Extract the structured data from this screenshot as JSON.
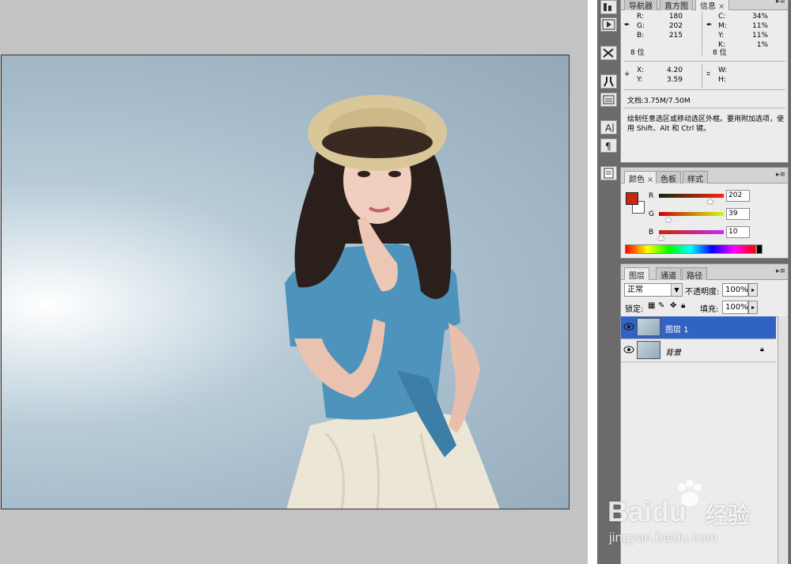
{
  "navigator_tabs": [
    "导航器",
    "直方图",
    "信息"
  ],
  "info": {
    "rgb_labels": [
      "R:",
      "G:",
      "B:"
    ],
    "rgb_values": [
      "180",
      "202",
      "215"
    ],
    "cmyk_labels": [
      "C:",
      "M:",
      "Y:",
      "K:"
    ],
    "cmyk_values": [
      "34%",
      "11%",
      "11%",
      "1%"
    ],
    "bit_left": "8 位",
    "bit_right": "8 位",
    "x_label": "X:",
    "y_label": "Y:",
    "x_value": "4.20",
    "y_value": "3.59",
    "w_label": "W:",
    "h_label": "H:",
    "doc_size": "文档:3.75M/7.50M",
    "hint": "绘制任意选区或移动选区外框。要用附加选项，使用 Shift、Alt 和 Ctrl 键。"
  },
  "color_panel": {
    "tabs": [
      "颜色",
      "色板",
      "样式"
    ],
    "r_label": "R",
    "g_label": "G",
    "b_label": "B",
    "r_value": "202",
    "g_value": "39",
    "b_value": "10",
    "r_level": 0.79,
    "g_level": 0.15,
    "b_level": 0.04,
    "foreground": "#ca270a",
    "background": "#ffffff"
  },
  "layers_panel": {
    "tabs": [
      "图层",
      "通道",
      "路径"
    ],
    "blend_mode": "正常",
    "opacity_label": "不透明度:",
    "opacity_value": "100%",
    "lock_label": "锁定:",
    "fill_label": "填充:",
    "fill_value": "100%",
    "layers": [
      {
        "name": "图层 1",
        "selected": true,
        "locked": false
      },
      {
        "name": "背景",
        "selected": false,
        "locked": true
      }
    ]
  },
  "watermark": {
    "logo": "Baidu",
    "brand_suffix": "经验",
    "url": "jingyan.baidu.com"
  },
  "colors": {
    "selection_blue": "#3163c4",
    "panel_bg": "#ececec",
    "dock_dark": "#6b6b6b"
  },
  "icons": [
    "histogram-icon",
    "play-icon",
    "tools-icon",
    "clone-source-icon",
    "brush-preset-icon",
    "character-icon",
    "paragraph-icon",
    "notes-icon"
  ]
}
